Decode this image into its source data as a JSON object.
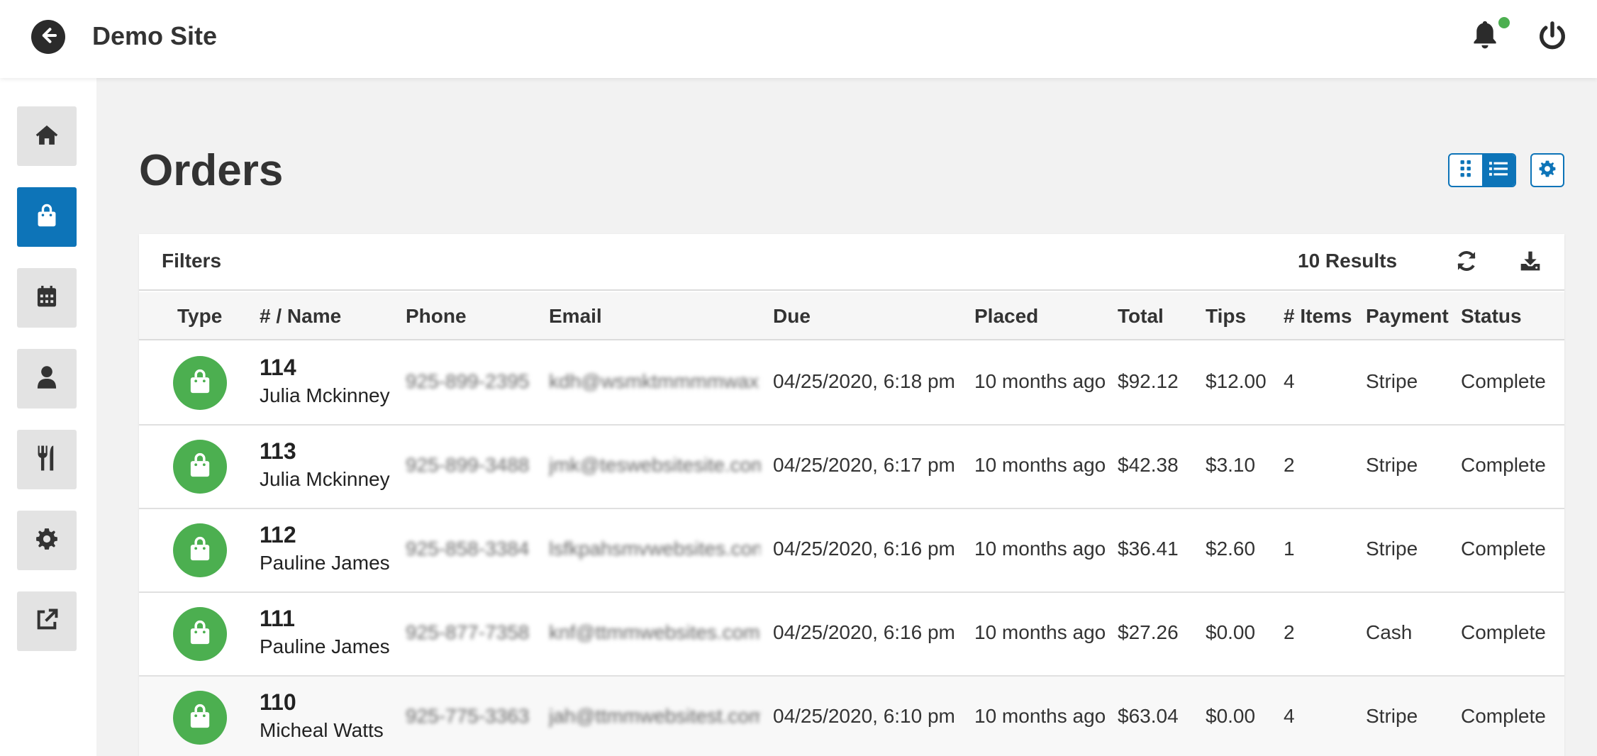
{
  "header": {
    "site_title": "Demo Site",
    "back_icon": "arrow-left-icon",
    "notification_icon": "bell-icon",
    "notification_dot_color": "#4caf50",
    "power_icon": "power-icon"
  },
  "sidebar": {
    "active_color": "#0d74b8",
    "items": [
      {
        "icon": "home-icon",
        "active": false
      },
      {
        "icon": "shopping-bag-icon",
        "active": true
      },
      {
        "icon": "calendar-icon",
        "active": false
      },
      {
        "icon": "user-icon",
        "active": false
      },
      {
        "icon": "utensils-icon",
        "active": false
      },
      {
        "icon": "gear-icon",
        "active": false
      },
      {
        "icon": "external-link-icon",
        "active": false
      }
    ]
  },
  "main": {
    "title": "Orders",
    "view_mode": "list",
    "accent_color": "#0d74b8"
  },
  "panel": {
    "filters_label": "Filters",
    "results_label": "10 Results",
    "columns": [
      "Type",
      "# / Name",
      "Phone",
      "Email",
      "Due",
      "Placed",
      "Total",
      "Tips",
      "# Items",
      "Payment",
      "Status"
    ],
    "type_icon_color": "#4caf50",
    "rows": [
      {
        "number": "114",
        "name": "Julia Mckinney",
        "phone": "925-899-2395",
        "email": "kdh@wsmktmmmmwaxrm.com",
        "due": "04/25/2020, 6:18 pm",
        "placed": "10 months ago",
        "total": "$92.12",
        "tips": "$12.00",
        "items": "4",
        "payment": "Stripe",
        "status": "Complete"
      },
      {
        "number": "113",
        "name": "Julia Mckinney",
        "phone": "925-899-3488",
        "email": "jmk@teswebsitesite.com",
        "due": "04/25/2020, 6:17 pm",
        "placed": "10 months ago",
        "total": "$42.38",
        "tips": "$3.10",
        "items": "2",
        "payment": "Stripe",
        "status": "Complete"
      },
      {
        "number": "112",
        "name": "Pauline James",
        "phone": "925-858-3384",
        "email": "lsfkpahsmvwebsites.com",
        "due": "04/25/2020, 6:16 pm",
        "placed": "10 months ago",
        "total": "$36.41",
        "tips": "$2.60",
        "items": "1",
        "payment": "Stripe",
        "status": "Complete"
      },
      {
        "number": "111",
        "name": "Pauline James",
        "phone": "925-877-7358",
        "email": "knf@ttmmwebsites.com",
        "due": "04/25/2020, 6:16 pm",
        "placed": "10 months ago",
        "total": "$27.26",
        "tips": "$0.00",
        "items": "2",
        "payment": "Cash",
        "status": "Complete"
      },
      {
        "number": "110",
        "name": "Micheal Watts",
        "phone": "925-775-3363",
        "email": "jah@ttmmwebsitest.com",
        "due": "04/25/2020, 6:10 pm",
        "placed": "10 months ago",
        "total": "$63.04",
        "tips": "$0.00",
        "items": "4",
        "payment": "Stripe",
        "status": "Complete"
      }
    ]
  }
}
